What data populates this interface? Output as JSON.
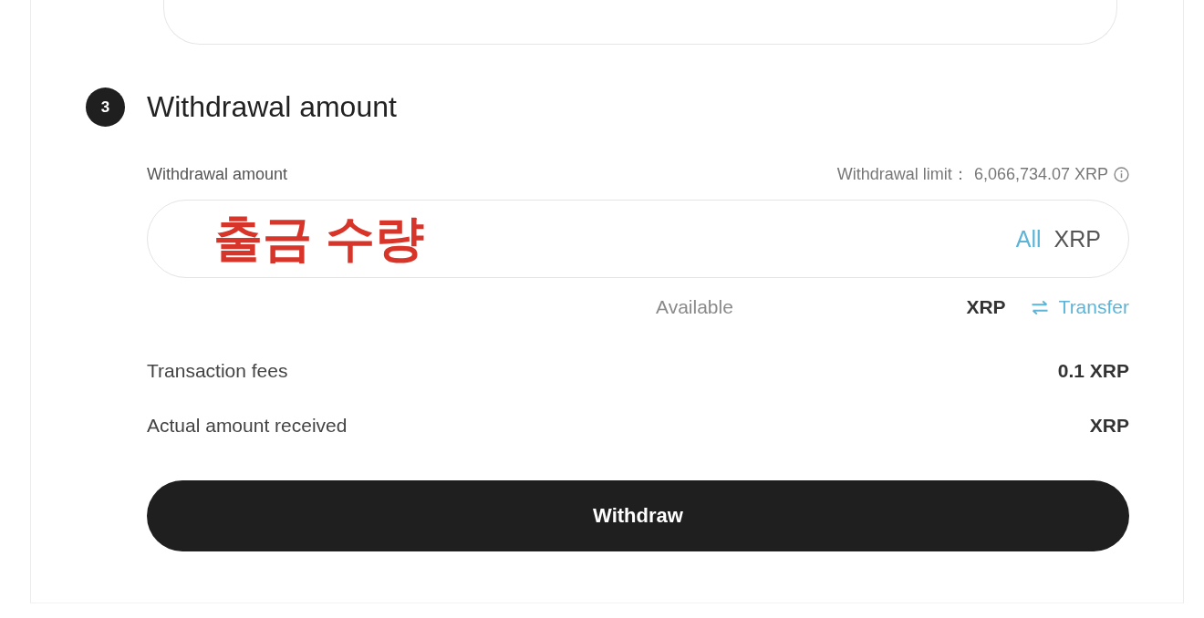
{
  "step": {
    "number": "3",
    "title": "Withdrawal amount"
  },
  "amount": {
    "label": "Withdrawal amount",
    "limit_label": "Withdrawal limit：",
    "limit_value": "6,066,734.07 XRP",
    "annotation": "출금 수량",
    "all": "All",
    "unit": "XRP"
  },
  "available": {
    "label": "Available",
    "unit": "XRP",
    "transfer": "Transfer"
  },
  "summary": [
    {
      "label": "Transaction fees",
      "value": "0.1 XRP"
    },
    {
      "label": "Actual amount received",
      "value": "XRP"
    }
  ],
  "button": "Withdraw"
}
